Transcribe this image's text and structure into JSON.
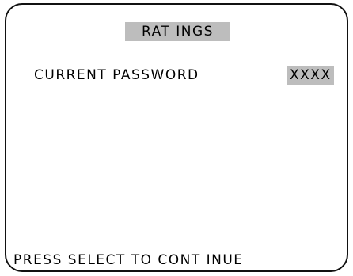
{
  "screen": {
    "title": "RAT INGS",
    "field_label": "CURRENT  PASSWORD",
    "field_value": "XXXX",
    "footer": "PRESS  SELECT  TO  CONT INUE"
  },
  "colors": {
    "highlight": "#bdbdbd",
    "text": "#000000",
    "background": "#ffffff"
  }
}
